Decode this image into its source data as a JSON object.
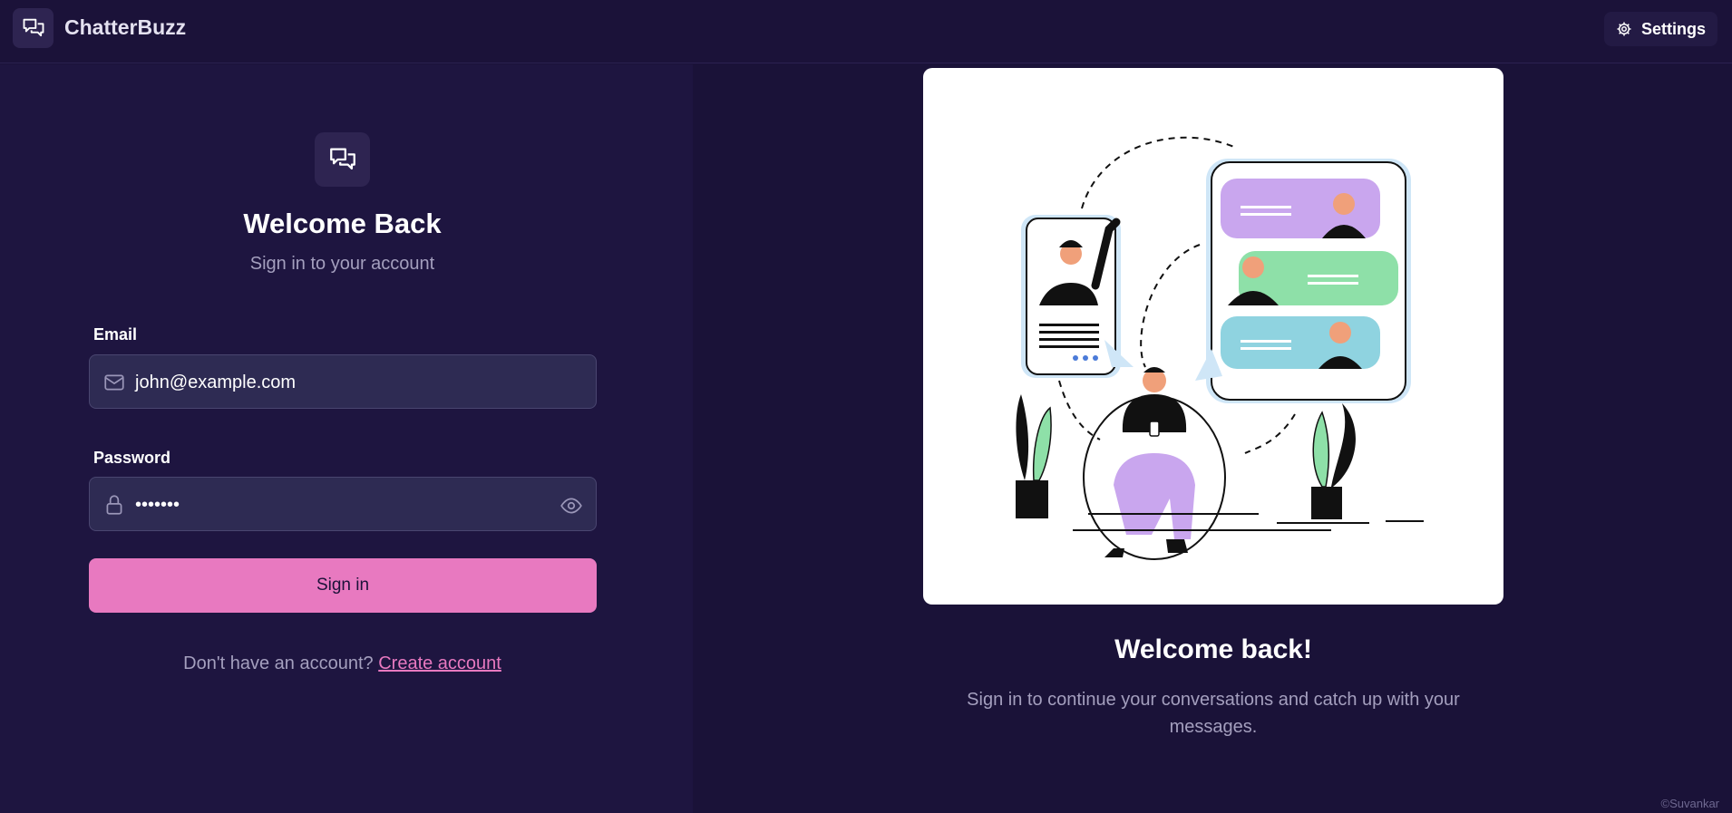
{
  "app": {
    "name": "ChatterBuzz",
    "settings_label": "Settings",
    "icons": {
      "brand": "chat-bubbles-icon",
      "settings": "gear-icon"
    }
  },
  "login": {
    "title": "Welcome Back",
    "subtitle": "Sign in to your account",
    "email": {
      "label": "Email",
      "value": "john@example.com",
      "icon": "mail-icon"
    },
    "password": {
      "label": "Password",
      "value": "•••••••",
      "icon": "lock-icon",
      "toggle_icon": "eye-icon"
    },
    "submit_label": "Sign in",
    "no_account_text": "Don't have an account?",
    "create_account_link": "Create account"
  },
  "promo": {
    "title": "Welcome back!",
    "text": "Sign in to continue your conversations and catch up with your messages."
  },
  "footer": {
    "credit": "©Suvankar"
  },
  "colors": {
    "background": "#1b1239",
    "accent": "#e879c0",
    "field_bg": "#2e2b53",
    "muted_text": "#a49fbe"
  }
}
